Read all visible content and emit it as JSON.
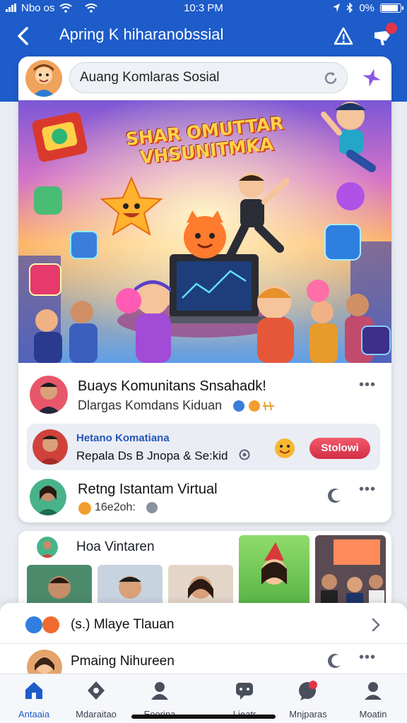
{
  "status_bar": {
    "carrier": "Nbo os",
    "time": "10:3 PM",
    "battery": "0%",
    "battery_level": 0.9
  },
  "app_bar": {
    "title": "Apring K hiharanobssial",
    "notification_count": ""
  },
  "search": {
    "value": "Auang Komlaras Sosial"
  },
  "hero": {
    "title": "SHAR OMUTTAR VHSUNITMKA"
  },
  "posts": [
    {
      "title": "Buays Komunitans Snsahadk!",
      "subtitle": "Dlargas Komdans Kiduan"
    },
    {
      "title": "Hetano Komatiana",
      "subtitle": "Repala Ds B Jnopa & Se:kid",
      "action": "Stolowi"
    },
    {
      "title": "Retng Istantam Virtual",
      "subtitle": "16e2oh:"
    }
  ],
  "gallery": {
    "title": "Hoa Vintaren"
  },
  "sheet": {
    "row1_label": "(s.) Mlaye Tlauan",
    "row2_label": "Pmaing Nihureen"
  },
  "nav": [
    {
      "label": "Antaaia"
    },
    {
      "label": "Mdaraitao"
    },
    {
      "label": "Eoorina"
    },
    {
      "label": "Lieatr"
    },
    {
      "label": "Mnjparas"
    },
    {
      "label": "Moatin"
    }
  ],
  "colors": {
    "brand": "#1d5cc9",
    "accent": "#e5344a",
    "purple": "#8a57e6"
  },
  "icons": [
    "back-icon",
    "alert-icon",
    "megaphone-icon",
    "refresh-icon",
    "sparkle-icon",
    "more-icon",
    "home-icon",
    "explore-icon",
    "people-icon",
    "chat-icon",
    "messages-icon",
    "profile-icon"
  ]
}
